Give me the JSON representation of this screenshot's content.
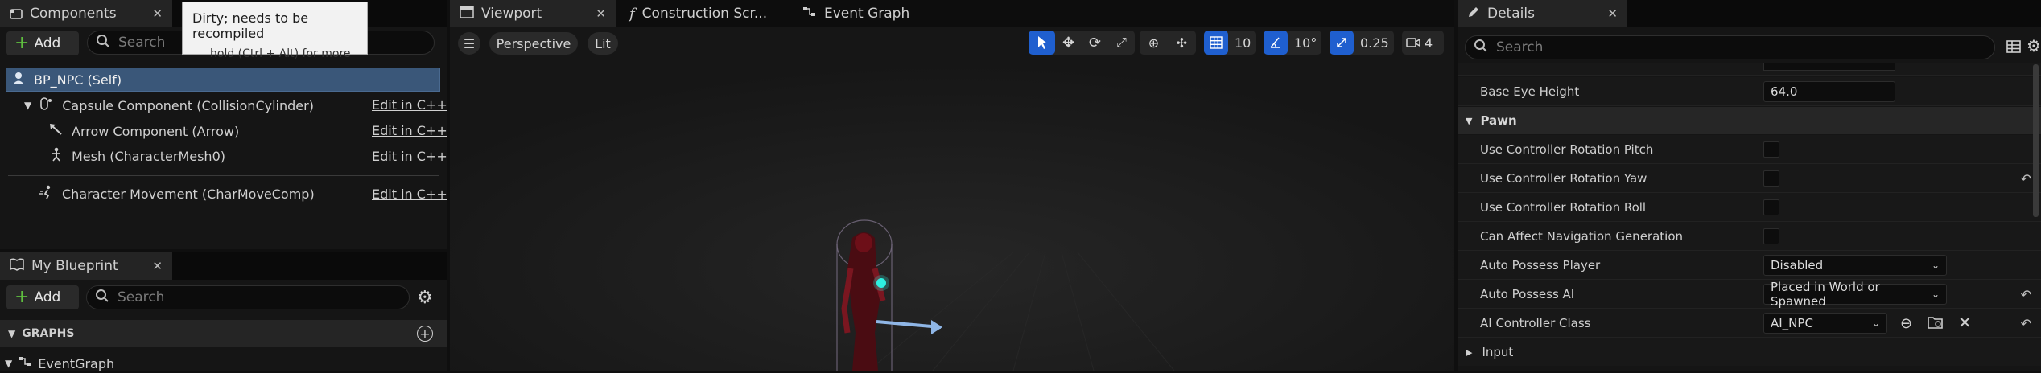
{
  "components_panel": {
    "tab_label": "Components",
    "add_label": "Add",
    "search_placeholder": "Search",
    "tooltip_title": "Dirty; needs to be recompiled",
    "tooltip_hint": "hold (Ctrl + Alt) for more",
    "root": "BP_NPC (Self)",
    "items": [
      {
        "label": "Capsule Component (CollisionCylinder)",
        "link": "Edit in C++"
      },
      {
        "label": "Arrow Component (Arrow)",
        "link": "Edit in C++"
      },
      {
        "label": "Mesh (CharacterMesh0)",
        "link": "Edit in C++"
      },
      {
        "label": "Character Movement (CharMoveComp)",
        "link": "Edit in C++"
      }
    ]
  },
  "my_blueprint": {
    "tab_label": "My Blueprint",
    "add_label": "Add",
    "search_placeholder": "Search",
    "section": "GRAPHS",
    "graph_item": "EventGraph"
  },
  "editor_tabs": {
    "viewport": "Viewport",
    "construction": "Construction Scr...",
    "event_graph": "Event Graph"
  },
  "viewport_toolbar": {
    "perspective": "Perspective",
    "lit": "Lit",
    "grid_snap": "10",
    "rotation_snap": "10°",
    "scale_snap": "0.25",
    "camera_speed": "4"
  },
  "details": {
    "tab_label": "Details",
    "search_placeholder": "Search",
    "base_eye_height_label": "Base Eye Height",
    "base_eye_height_value": "64.0",
    "pawn_category": "Pawn",
    "rows": [
      {
        "label": "Use Controller Rotation Pitch"
      },
      {
        "label": "Use Controller Rotation Yaw"
      },
      {
        "label": "Use Controller Rotation Roll"
      },
      {
        "label": "Can Affect Navigation Generation"
      }
    ],
    "auto_possess_player_label": "Auto Possess Player",
    "auto_possess_player_value": "Disabled",
    "auto_possess_ai_label": "Auto Possess AI",
    "auto_possess_ai_value": "Placed in World or Spawned",
    "ai_controller_label": "AI Controller Class",
    "ai_controller_value": "AI_NPC",
    "input_category": "Input"
  },
  "colors": {
    "accent_blue": "#1f5fcf",
    "selection": "#2b4a6b"
  }
}
